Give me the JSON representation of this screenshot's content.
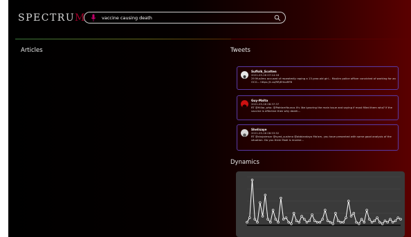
{
  "app": {
    "logo_main": "SPECTRU",
    "logo_accent": "M"
  },
  "search": {
    "query": "vaccine causing death",
    "mic_icon": "microphone-icon",
    "search_icon": "search-icon"
  },
  "sections": {
    "articles": "Articles",
    "tweets": "Tweets",
    "dynamics": "Dynamics"
  },
  "tweets": [
    {
      "user": "Suffolk_Scotten",
      "date": "2021-05-16 07:14:18",
      "text": "29 Muslims accused of repeatedly raping a 13-year-old girl... Muslim police officer convicted of working for an OCG... https://t.co/RRjEHnaRFB",
      "avatar_color": "#e6e6e6"
    },
    {
      "user": "Guy-Malta",
      "date": "2021-05-16 06:37:37",
      "text": "RT @Hillar_who: @PatriamYounus It's like ignoring the main issue and saying if most filled them who? If the vaccine is effective then why death...",
      "avatar_color": "#cc1111"
    },
    {
      "user": "Shelisaye",
      "date": "2021-05-16 06:53:52",
      "text": "RT @shojaimsar @syed_sushmo @abbiandayo Ma'am, you have presented with some good analysis of the situation. Do you think Modi is involve...",
      "avatar_color": "#d8d8d8"
    }
  ],
  "chart_data": {
    "type": "line",
    "xlabel": "",
    "ylabel": "",
    "grid": true,
    "y": [
      2,
      5,
      30,
      4,
      2,
      15,
      6,
      20,
      4,
      2,
      10,
      4,
      2,
      18,
      4,
      5,
      2,
      1,
      8,
      3,
      2,
      6,
      4,
      2,
      3,
      7,
      3,
      2,
      2,
      4,
      10,
      3,
      2,
      1,
      8,
      3,
      2,
      2,
      5,
      16,
      6,
      8,
      2,
      1,
      4,
      2,
      10,
      4,
      2,
      3,
      5,
      2,
      1,
      3,
      2,
      4,
      2,
      3,
      5,
      4
    ],
    "ylim": [
      0,
      32
    ],
    "line_color": "#ffffff",
    "marker_color": "#ffffff"
  }
}
